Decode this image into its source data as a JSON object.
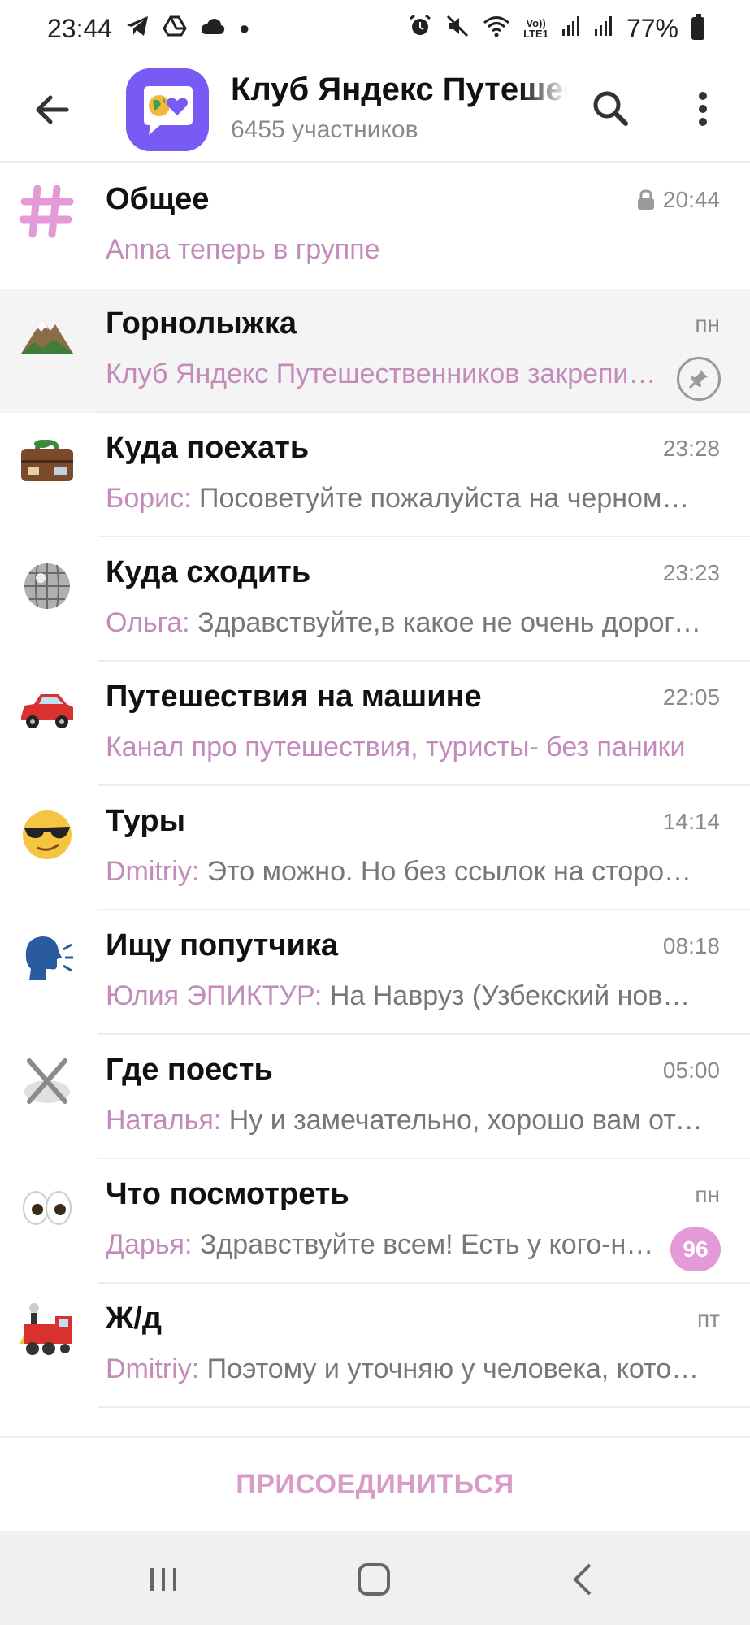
{
  "status_bar": {
    "time": "23:44",
    "battery": "77%",
    "lte_label": "Vo))\nLTE1",
    "left_icons": [
      "telegram-icon",
      "drive-icon",
      "cloud-icon",
      "dot-icon"
    ],
    "right_icons": [
      "alarm-icon",
      "mute-icon",
      "wifi-icon",
      "lte-icon",
      "signal-icon",
      "signal-icon",
      "battery-icon"
    ]
  },
  "header": {
    "title": "Клуб Яндекс Путешественников",
    "members": "6455 участников"
  },
  "chats": [
    {
      "icon": "#",
      "icon_name": "hash-icon",
      "name": "Общее",
      "time": "20:44",
      "locked": true,
      "sender": "",
      "preview": "Anna теперь в группе",
      "preview_accent": true
    },
    {
      "icon": "🏔",
      "icon_name": "mountain-icon",
      "name": "Горнолыжка",
      "time": "пн",
      "pinned": true,
      "sender": "",
      "preview": "Клуб Яндекс Путешественников закрепил(а) сообщение",
      "preview_accent": true
    },
    {
      "icon": "🧳",
      "icon_name": "suitcase-icon",
      "name": "Куда поехать",
      "time": "23:28",
      "sender": "Борис:",
      "preview": "Посоветуйте пожалуйста на черноморском побережье"
    },
    {
      "icon": "🪩",
      "icon_name": "disco-ball-icon",
      "name": "Куда сходить",
      "time": "23:23",
      "sender": "Ольга:",
      "preview": "Здравствуйте,в какое не очень дорогое место"
    },
    {
      "icon": "🚗",
      "icon_name": "car-icon",
      "name": "Путешествия на машине",
      "time": "22:05",
      "sender": "",
      "preview": "Канал про путешествия, туристы- без паники",
      "preview_accent": true
    },
    {
      "icon": "😎",
      "icon_name": "sunglasses-face-icon",
      "name": "Туры",
      "time": "14:14",
      "sender": "Dmitriy:",
      "preview": "Это можно. Но без ссылок на сторонние ресурсы"
    },
    {
      "icon": "🗣",
      "icon_name": "speaking-head-icon",
      "name": "Ищу попутчика",
      "time": "08:18",
      "sender": "Юлия ЭПИКТУР:",
      "preview": "На Навруз (Узбекский новый год)"
    },
    {
      "icon": "🍽",
      "icon_name": "fork-knife-icon",
      "name": "Где поесть",
      "time": "05:00",
      "sender": "Наталья:",
      "preview": "Ну и замечательно, хорошо вам отдохнуть"
    },
    {
      "icon": "👀",
      "icon_name": "eyes-icon",
      "name": "Что посмотреть",
      "time": "пн",
      "unread": "96",
      "sender": "Дарья:",
      "preview": "Здравствуйте всем! Есть у кого-нибудь"
    },
    {
      "icon": "🚂",
      "icon_name": "locomotive-icon",
      "name": "Ж/д",
      "time": "пт",
      "sender": "Dmitriy:",
      "preview": "Поэтому и уточняю у человека, который был"
    }
  ],
  "join_label": "ПРИСОЕДИНИТЬСЯ",
  "colors": {
    "accent_pink": "#c38bbb",
    "badge_pink": "#e59ad8",
    "join_pink": "#d99cc9",
    "avatar_purple": "#7a5af5"
  }
}
